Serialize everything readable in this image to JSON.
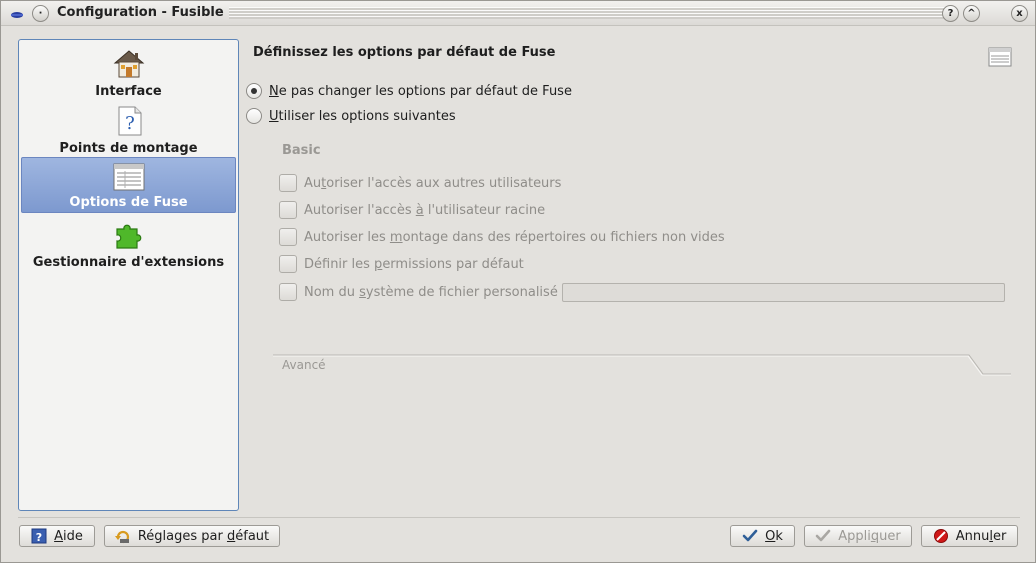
{
  "window": {
    "title": "Configuration - Fusible",
    "help_button": "?",
    "shade_button": "^",
    "close_button": "x"
  },
  "sidebar": {
    "items": [
      {
        "label": "Interface",
        "icon": "house-icon"
      },
      {
        "label": "Points de montage",
        "icon": "question-document-icon"
      },
      {
        "label": "Options de Fuse",
        "icon": "list-options-icon",
        "selected": true
      },
      {
        "label": "Gestionnaire d'extensions",
        "icon": "puzzle-piece-icon"
      }
    ]
  },
  "main": {
    "title": "Définissez les options par défaut de Fuse",
    "radio_keep": {
      "mnemonic": "N",
      "rest": "e pas changer les options par défaut de Fuse",
      "checked": true
    },
    "radio_custom": {
      "mnemonic": "U",
      "rest": "tiliser les options suivantes",
      "checked": false
    },
    "group_basic": "Basic",
    "options": [
      {
        "pre": "Au",
        "mn": "t",
        "post": "oriser l'accès aux autres utilisateurs"
      },
      {
        "pre": "Autoriser l'accès ",
        "mn": "à",
        "post": " l'utilisateur racine"
      },
      {
        "pre": "Autoriser les ",
        "mn": "m",
        "post": "ontage dans des répertoires ou fichiers non vides"
      },
      {
        "pre": "Définir les ",
        "mn": "p",
        "post": "ermissions par défaut"
      },
      {
        "pre": "Nom du ",
        "mn": "s",
        "post": "ystème de fichier personalisé :"
      }
    ],
    "fs_name_value": "",
    "advanced_label": "Avancé"
  },
  "buttons": {
    "help": {
      "mn": "A",
      "rest": "ide"
    },
    "defaults": {
      "pre": "Réglages par ",
      "mn": "d",
      "post": "éfaut"
    },
    "ok": {
      "mn": "O",
      "rest": "k"
    },
    "apply": {
      "pre": "Appli",
      "mn": "q",
      "post": "uer"
    },
    "cancel": {
      "pre": "Annu",
      "mn": "l",
      "post": "er"
    }
  },
  "colors": {
    "selection": "#7d99cf",
    "sidebar_border": "#5f86b8",
    "cancel_icon": "#d01818",
    "ok_icon": "#3a6fa8"
  }
}
